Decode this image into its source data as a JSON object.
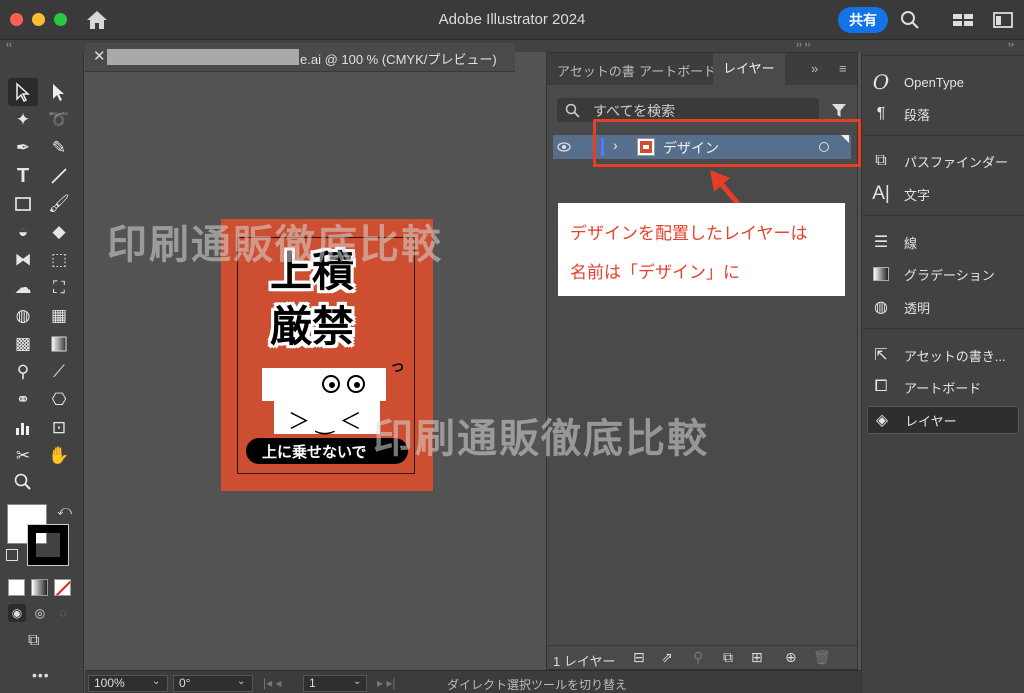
{
  "window": {
    "title": "Adobe Illustrator 2024",
    "share_label": "共有"
  },
  "document": {
    "tab_title": "e.ai @ 100 % (CMYK/プレビュー)"
  },
  "canvas": {
    "watermark_text": "印刷通販徹底比較",
    "artwork": {
      "title_line1": "上積",
      "title_line2": "厳禁",
      "banner_text": "上に乗せないで",
      "squiggle": "っ",
      "face_mouth": "＞‿＜"
    }
  },
  "layers_panel": {
    "tabs": [
      "アセットの書",
      "アートボード",
      "レイヤー"
    ],
    "overflow": "»",
    "search_placeholder": "すべてを検索",
    "layer": {
      "name": "デザイン",
      "visible": true
    },
    "footer_count": "1 レイヤー"
  },
  "annotation": {
    "line1": "デザインを配置したレイヤーは",
    "line2": "名前は「デザイン」に",
    "color": "#e8402a"
  },
  "right_dock": {
    "items": [
      {
        "label": "OpenType",
        "icon": "opentype-icon"
      },
      {
        "label": "段落",
        "icon": "paragraph-icon"
      },
      {
        "label": "パスファインダー",
        "icon": "pathfinder-icon"
      },
      {
        "label": "文字",
        "icon": "character-icon"
      },
      {
        "label": "線",
        "icon": "stroke-icon"
      },
      {
        "label": "グラデーション",
        "icon": "gradient-icon"
      },
      {
        "label": "透明",
        "icon": "transparency-icon"
      },
      {
        "label": "アセットの書き...",
        "icon": "asset-export-icon"
      },
      {
        "label": "アートボード",
        "icon": "artboards-icon"
      },
      {
        "label": "レイヤー",
        "icon": "layers-icon",
        "active": true
      }
    ]
  },
  "status_bar": {
    "zoom": "100%",
    "rotation": "0°",
    "artboard_num": "1",
    "hint": "ダイレクト選択ツールを切り替え"
  },
  "colors": {
    "accent": "#1473e6",
    "artboard": "#cd4e30",
    "selected_layer": "#566f8c",
    "highlight": "#e53e26"
  }
}
